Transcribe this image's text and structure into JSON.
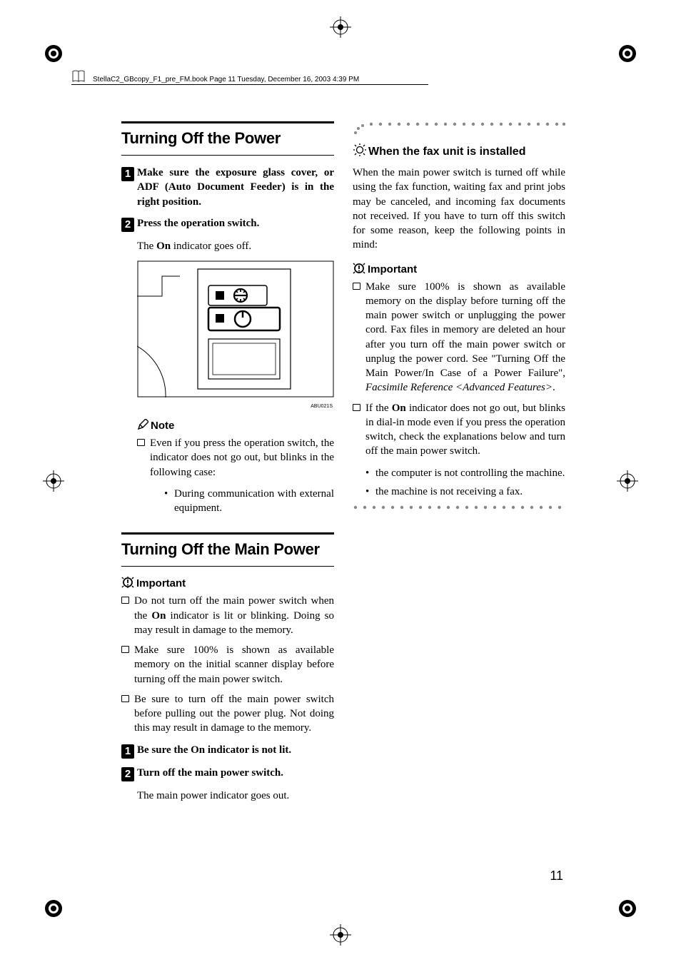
{
  "header": {
    "text": "StellaC2_GBcopy_F1_pre_FM.book  Page 11  Tuesday, December 16, 2003  4:39 PM"
  },
  "col1": {
    "h2a": "Turning Off the Power",
    "step1": "Make sure the exposure glass cover, or ADF (Auto Document Feeder) is in the right position.",
    "step2": "Press the operation switch.",
    "step2_body": "The On indicator goes off.",
    "ill_caption": "ABU021S",
    "note_label": "Note",
    "note_item": "Even if you press the operation switch, the indicator does not go out, but blinks in the following case:",
    "note_bullet": "During communication with external equipment.",
    "h2b": "Turning Off the Main Power",
    "imp_label": "Important",
    "imp1": "Do not turn off the main power switch when the On indicator is lit or blinking. Doing so may result in damage to the memory.",
    "imp2": "Make sure 100% is shown as available memory on the initial scanner display before turning off the main power switch.",
    "imp3": "Be sure to turn off the main power switch before pulling out the power plug. Not doing this may result in damage to the memory.",
    "stepB1": "Be sure the On indicator is not lit.",
    "stepB2": "Turn off the main power switch.",
    "stepB2_body": "The main power indicator goes out."
  },
  "col2": {
    "tip_head": "When the fax unit is installed",
    "body": "When the main power switch is turned off while using the fax function, waiting fax and print jobs may be canceled, and incoming fax documents not received. If you have to turn off this switch for some reason, keep the following points in mind:",
    "imp_label": "Important",
    "imp1_a": "Make sure 100% is shown as available memory on the display before turning off the main power switch or unplugging the power cord. Fax files in memory are deleted an hour after you turn off the main power switch or unplug the power cord. See \"Turning Off the Main Power/In Case of a Power Failure\", ",
    "imp1_b": "Facsimile Reference <Advanced Features>",
    "imp1_c": ".",
    "imp2_a": "If the ",
    "imp2_b": "On",
    "imp2_c": " indicator does not go out, but blinks in dial-in mode even if you press the operation switch, check the explanations below and turn off the main power switch.",
    "bul1": "the computer is not controlling the machine.",
    "bul2": "the machine is not receiving a fax."
  },
  "page_number": "11",
  "on_label": "On"
}
